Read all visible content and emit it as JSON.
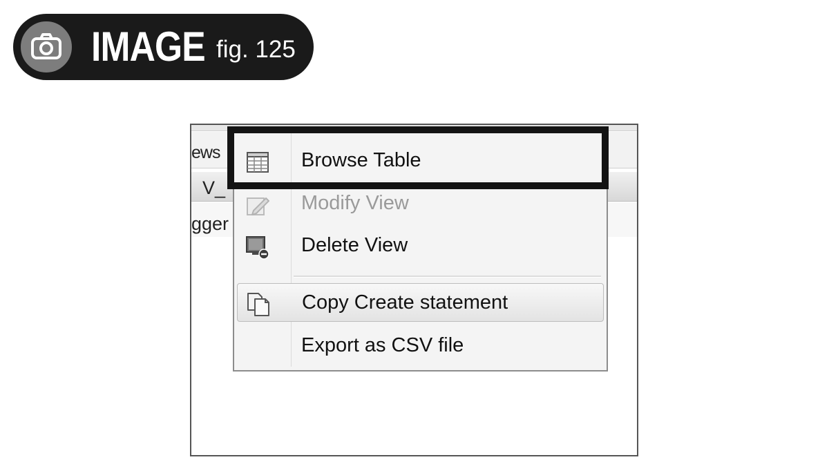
{
  "figure_label": {
    "word": "IMAGE",
    "number": "fig. 125",
    "icon": "camera-icon"
  },
  "background_app": {
    "tab_text": "ews",
    "header_text": "V_",
    "body_text": "gger"
  },
  "context_menu": {
    "items": [
      {
        "label": "Browse Table",
        "icon": "table-grid-icon",
        "enabled": true,
        "highlighted_by_callout": true
      },
      {
        "label": "Modify View",
        "icon": "pencil-edit-icon",
        "enabled": false
      },
      {
        "label": "Delete View",
        "icon": "delete-view-icon",
        "enabled": true
      },
      {
        "label": "Copy Create statement",
        "icon": "copy-pages-icon",
        "enabled": true,
        "hovered": true
      },
      {
        "label": "Export as CSV file",
        "icon": "",
        "enabled": true
      }
    ]
  },
  "colors": {
    "label_bg": "#1a1a1a",
    "camera_circle": "#7d7d7d",
    "menu_bg": "#f4f4f4",
    "disabled_text": "#9a9a9a",
    "callout_border": "#141414"
  }
}
